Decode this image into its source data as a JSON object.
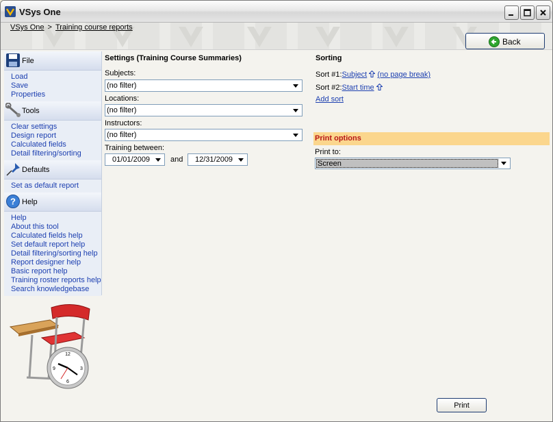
{
  "window": {
    "title": "VSys One"
  },
  "breadcrumb": {
    "root": "VSys One",
    "separator": ">",
    "current": "Training course reports"
  },
  "back_button": {
    "label": "Back"
  },
  "sidebar": {
    "file": {
      "label": "File",
      "items": [
        "Load",
        "Save",
        "Properties"
      ]
    },
    "tools": {
      "label": "Tools",
      "items": [
        "Clear settings",
        "Design report",
        "Calculated fields",
        "Detail filtering/sorting"
      ]
    },
    "defaults": {
      "label": "Defaults",
      "items": [
        "Set as default report"
      ]
    },
    "help": {
      "label": "Help",
      "items": [
        "Help",
        "About this tool",
        "Calculated fields help",
        "Set default report help",
        "Detail filtering/sorting help",
        "Report designer help",
        "Basic report help",
        "Training roster reports help",
        "Search knowledgebase"
      ]
    }
  },
  "settings": {
    "title": "Settings (Training Course Summaries)",
    "subjects": {
      "label": "Subjects:",
      "value": "(no filter)"
    },
    "locations": {
      "label": "Locations:",
      "value": "(no filter)"
    },
    "instructors": {
      "label": "Instructors:",
      "value": "(no filter)"
    },
    "training_between": {
      "label": "Training between:",
      "from": "01/01/2009",
      "and": "and",
      "to": "12/31/2009"
    }
  },
  "sorting": {
    "title": "Sorting",
    "sort1": {
      "label": "Sort #1:",
      "field": "Subject",
      "extra": "(no page break)"
    },
    "sort2": {
      "label": "Sort #2:",
      "field": "Start time"
    },
    "add_sort": "Add sort"
  },
  "print_options": {
    "title": "Print options",
    "print_to_label": "Print to:",
    "print_to_value": "Screen"
  },
  "print_button": {
    "label": "Print"
  },
  "icons": [
    "app-icon",
    "minimize-icon",
    "maximize-icon",
    "close-icon",
    "back-arrow-icon",
    "floppy-disk-icon",
    "wrench-icon",
    "pushpin-icon",
    "help-icon",
    "up-arrow-icon",
    "chevron-down-icon"
  ],
  "colors": {
    "link": "#1c3fb0",
    "print_options_bg": "#fbd68d",
    "print_options_text": "#b81616",
    "sidebar_bg": "#dfe6f1"
  }
}
